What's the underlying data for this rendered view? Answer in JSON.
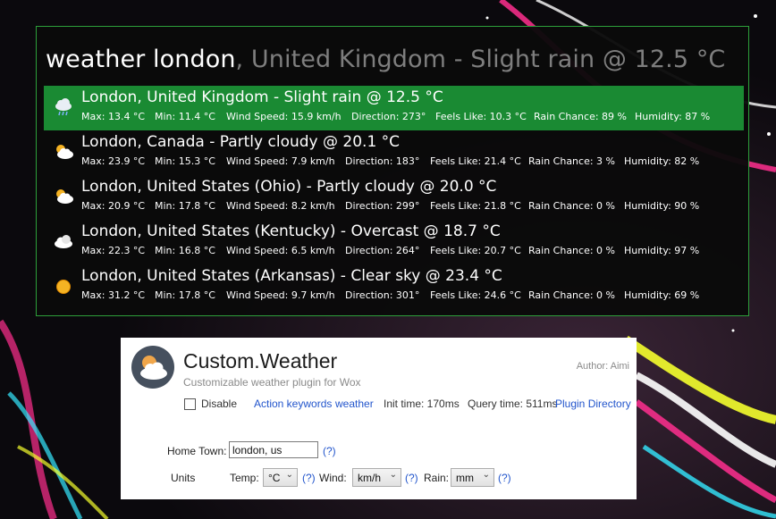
{
  "launcher": {
    "query_typed": "weather london",
    "query_suggestion": ", United Kingdom - Slight rain @ 12.5 °C",
    "results": [
      {
        "icon": "rain-cloud-icon",
        "selected": true,
        "title": "London, United Kingdom - Slight rain @ 12.5 °C",
        "max": "Max: 13.4 °C",
        "min": "Min: 11.4 °C",
        "wind": "Wind Speed: 15.9 km/h",
        "direction": "Direction: 273°",
        "feels": "Feels Like: 10.3 °C",
        "rain": "Rain Chance: 89 %",
        "humidity": "Humidity: 87 %"
      },
      {
        "icon": "partly-cloudy-icon",
        "selected": false,
        "title": "London, Canada - Partly cloudy @ 20.1 °C",
        "max": "Max: 23.9 °C",
        "min": "Min: 15.3 °C",
        "wind": "Wind Speed: 7.9 km/h",
        "direction": "Direction: 183°",
        "feels": "Feels Like: 21.4 °C",
        "rain": "Rain Chance: 3 %",
        "humidity": "Humidity: 82 %"
      },
      {
        "icon": "partly-cloudy-icon",
        "selected": false,
        "title": "London, United States (Ohio) - Partly cloudy @ 20.0 °C",
        "max": "Max: 20.9 °C",
        "min": "Min: 17.8 °C",
        "wind": "Wind Speed: 8.2 km/h",
        "direction": "Direction: 299°",
        "feels": "Feels Like: 21.8 °C",
        "rain": "Rain Chance: 0 %",
        "humidity": "Humidity: 90 %"
      },
      {
        "icon": "overcast-icon",
        "selected": false,
        "title": "London, United States (Kentucky) - Overcast @ 18.7 °C",
        "max": "Max: 22.3 °C",
        "min": "Min: 16.8 °C",
        "wind": "Wind Speed: 6.5 km/h",
        "direction": "Direction: 264°",
        "feels": "Feels Like: 20.7 °C",
        "rain": "Rain Chance: 0 %",
        "humidity": "Humidity: 97 %"
      },
      {
        "icon": "sun-icon",
        "selected": false,
        "title": "London, United States (Arkansas) - Clear sky @ 23.4 °C",
        "max": "Max: 31.2 °C",
        "min": "Min: 17.8 °C",
        "wind": "Wind Speed: 9.7 km/h",
        "direction": "Direction: 301°",
        "feels": "Feels Like: 24.6 °C",
        "rain": "Rain Chance: 0 %",
        "humidity": "Humidity: 69 %"
      }
    ]
  },
  "plugin": {
    "name": "Custom.Weather",
    "description": "Customizable weather plugin for Wox",
    "author": "Author: Aimi",
    "disable_label": "Disable",
    "action_keywords_label": "Action keywords",
    "action_keyword": "weather",
    "init_time": "Init time: 170ms",
    "query_time": "Query time: 511ms",
    "plugin_directory": "Plugin Directory",
    "home_town_label": "Home Town:",
    "home_town_value": "london, us",
    "help": "(?)",
    "units_label": "Units",
    "temp_label": "Temp:",
    "temp_value": "°C",
    "wind_label": "Wind:",
    "wind_value": "km/h",
    "rain_label": "Rain:",
    "rain_value": "mm"
  },
  "colors": {
    "selected_bg": "#1a8a33",
    "launcher_border": "#2d9f3a",
    "link": "#2255cc"
  }
}
